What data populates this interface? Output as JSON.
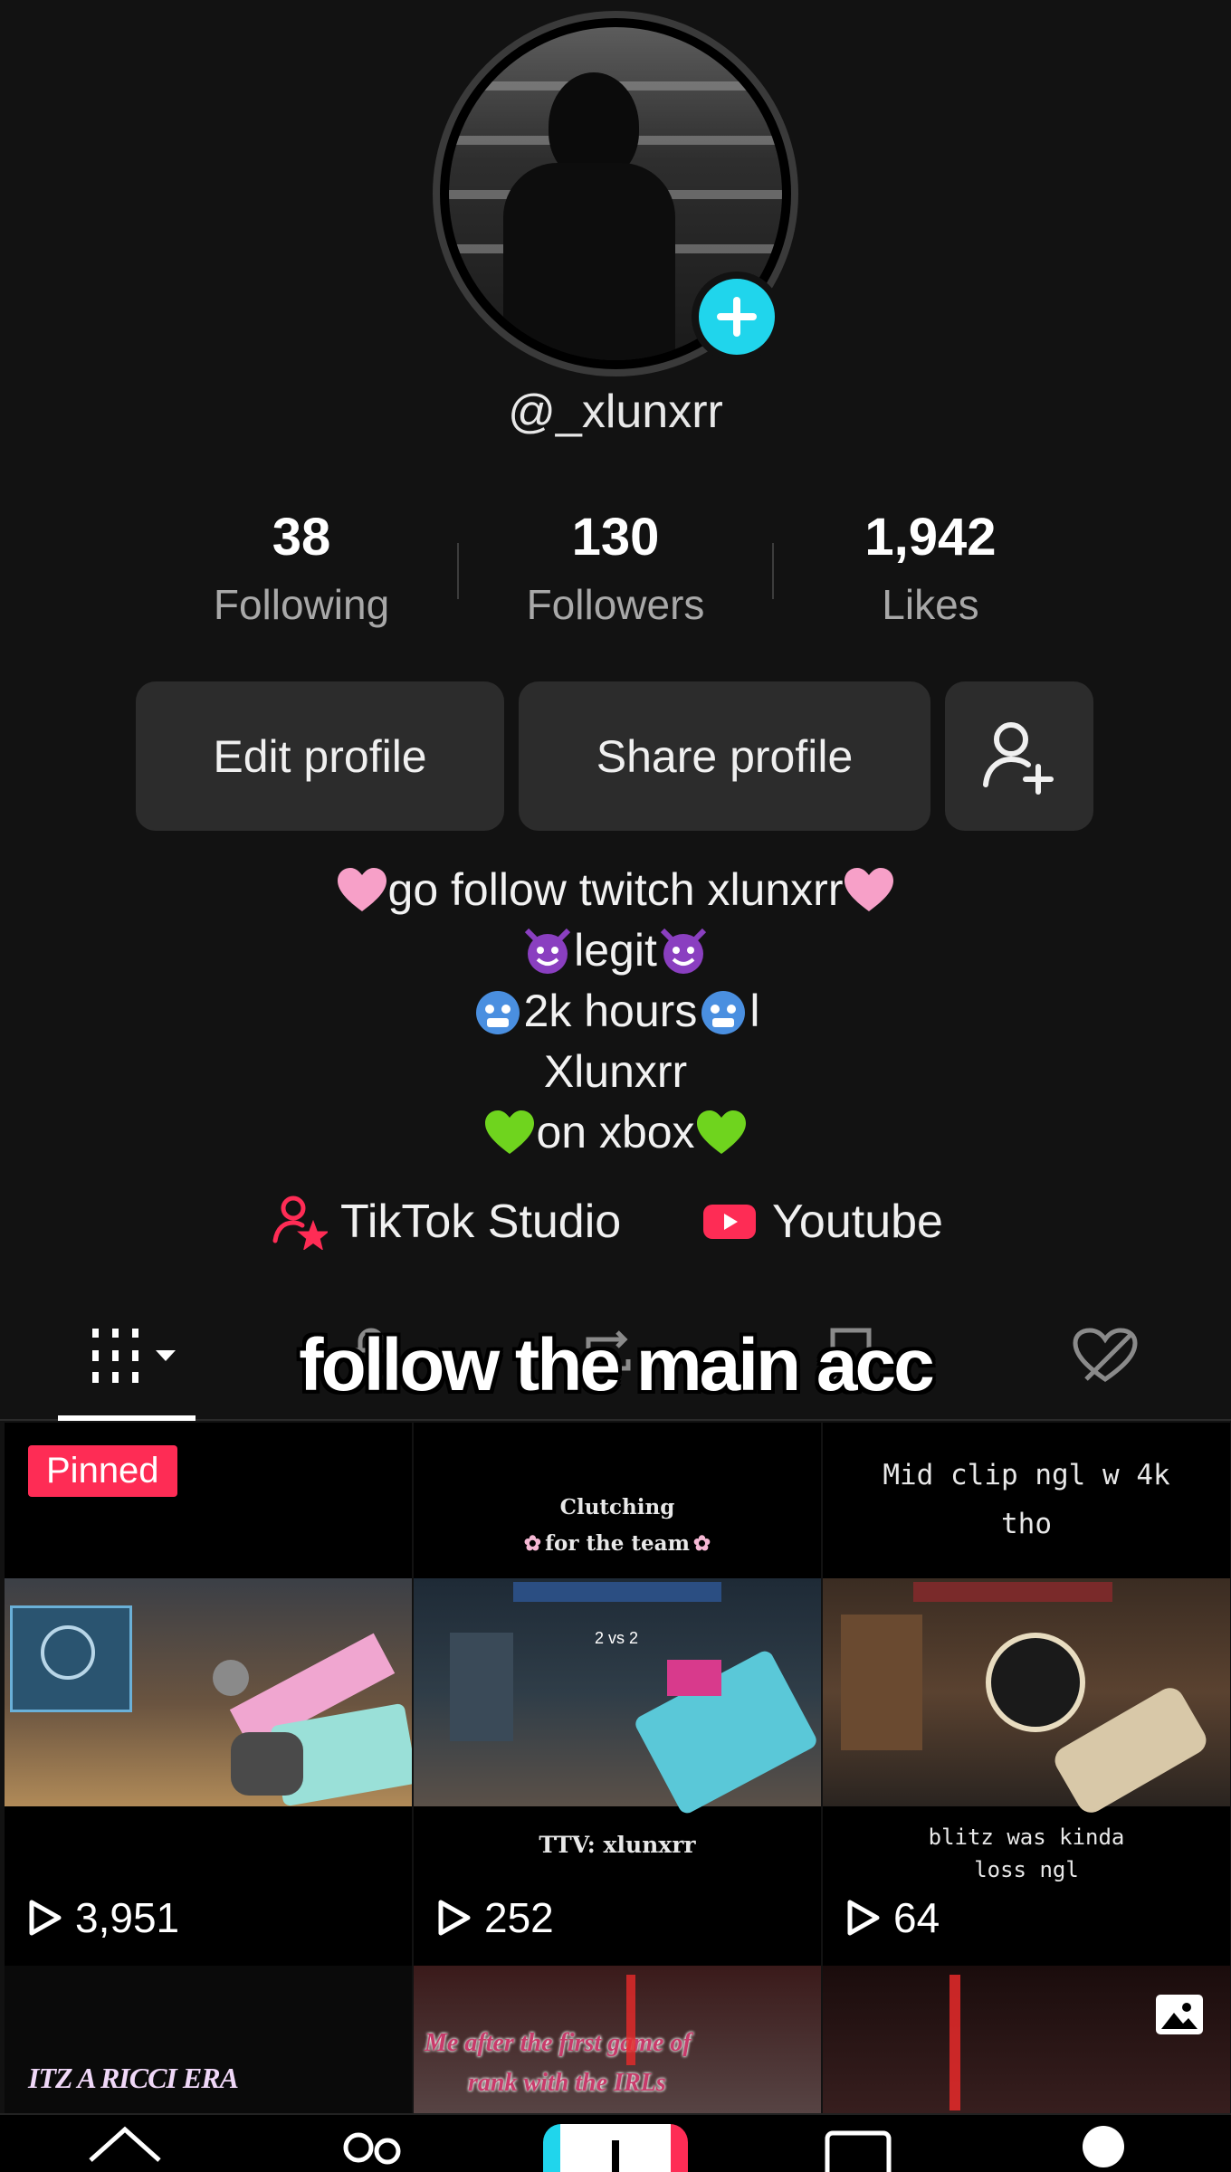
{
  "profile": {
    "username": "@_xlunxrr",
    "avatar_icon": "avatar-photo",
    "add_icon": "plus-icon"
  },
  "stats": [
    {
      "value": "38",
      "label": "Following"
    },
    {
      "value": "130",
      "label": "Followers"
    },
    {
      "value": "1,942",
      "label": "Likes"
    }
  ],
  "actions": {
    "edit_profile": "Edit profile",
    "share_profile": "Share profile",
    "add_friend_icon": "add-user-icon"
  },
  "bio": {
    "line1": "go follow twitch xlunxrr",
    "line2": "legit",
    "line3": "2k hours",
    "line3_suffix": "l",
    "line4": "Xlunxrr",
    "line5": "on xbox"
  },
  "links": {
    "studio": "TikTok Studio",
    "youtube": "Youtube"
  },
  "overlay_text": "follow the main acc",
  "videos": [
    {
      "pinned_label": "Pinned",
      "caption_top": "",
      "caption_bottom": "",
      "views": "3,951"
    },
    {
      "caption_top_line1": "Clutching",
      "caption_top_line2": "for the team",
      "caption_bottom": "TTV: xlunxrr",
      "views": "252",
      "hud_score": "2 vs 2"
    },
    {
      "caption_top_line1": "Mid clip ngl w 4k",
      "caption_top_line2": "tho",
      "caption_bottom_line1": "blitz was kinda",
      "caption_bottom_line2": "loss ngl",
      "views": "64"
    }
  ],
  "videos_row2": [
    {
      "caption": "ITZ A RICCI ERA"
    },
    {
      "caption_line1": "Me after the first game of",
      "caption_line2": "rank with the IRLs"
    },
    {
      "caption": ""
    }
  ],
  "colors": {
    "background": "#121212",
    "accent_cyan": "#20d5ec",
    "accent_red": "#fe2c55",
    "button_bg": "#2c2c2c"
  }
}
